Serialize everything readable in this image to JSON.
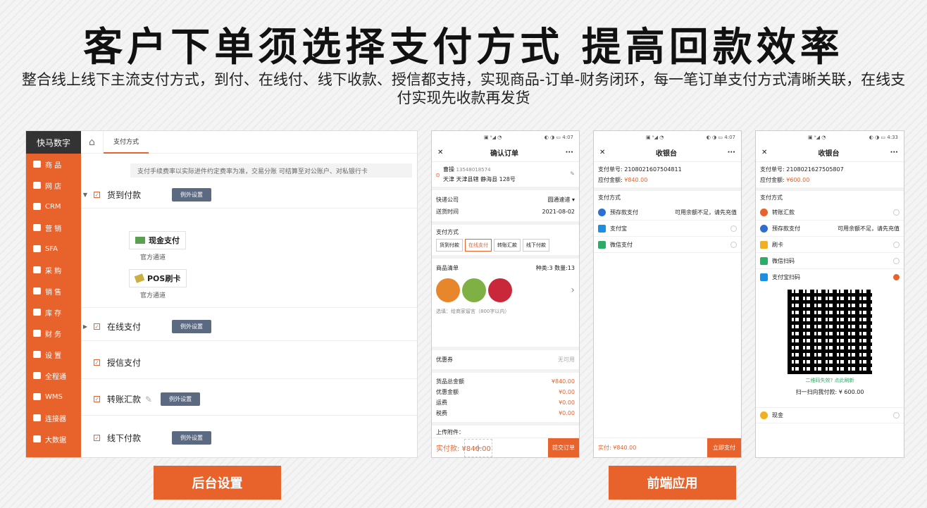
{
  "header": {
    "title": "客户下单须选择支付方式  提高回款效率",
    "subtitle": "整合线上线下主流支付方式，到付、在线付、线下收款、授信都支持，实现商品-订单-财务闭环，每一笔订单支付方式清晰关联，在线支付实现先收款再发货"
  },
  "admin": {
    "brand": "快马数字",
    "nav": [
      "商 品",
      "网 店",
      "CRM",
      "营 销",
      "SFA",
      "采 购",
      "销 售",
      "库 存",
      "财 务",
      "设 置",
      "全程通",
      "WMS",
      "连接器",
      "大数据"
    ],
    "tab": "支付方式",
    "note": "支付手续费率以实际进件约定费率为准，交易分账 可结算至对公账户、对私银行卡",
    "groups": [
      {
        "label": "货到付款",
        "ex": "例外设置"
      },
      {
        "label": "在线支付",
        "ex": "例外设置"
      },
      {
        "label": "授信支付"
      },
      {
        "label": "转账汇款",
        "ex": "例外设置"
      },
      {
        "label": "线下付款",
        "ex": "例外设置"
      }
    ],
    "cash": {
      "name": "现金支付",
      "sub": "官方通道"
    },
    "pos": {
      "name": "POS刷卡",
      "sub": "官方通道"
    }
  },
  "phone1": {
    "status_left": "▣ ᵃ◢ ◔",
    "status_right": "◐ ◑ ▭ 4:07",
    "title": "确认订单",
    "name": "曹操",
    "phone": "13548018574",
    "addr": "天津 天津县辖 静海县 128号",
    "ship_label": "快递公司",
    "ship_val": "圆通速递",
    "date_label": "送货时间",
    "date_val": "2021-08-02",
    "pay_label": "支付方式",
    "chips": [
      "货到付款",
      "在线支付",
      "转账汇款",
      "线下付款"
    ],
    "list_label": "商品清单",
    "list_val": "种类:3 数量:13",
    "memo": "选填：给商家留言（800字以内）",
    "coupon_label": "优惠券",
    "coupon_val": "无可用",
    "sum": [
      [
        "货品总金额",
        "¥840.00"
      ],
      [
        "优惠金额",
        "¥0.00"
      ],
      [
        "运费",
        "¥0.00"
      ],
      [
        "税费",
        "¥0.00"
      ]
    ],
    "attach": "上传附件：",
    "total": "实付款: ¥840.00",
    "submit": "提交订单"
  },
  "phone2": {
    "status_left": "▣ ᵃ◢ ◔",
    "status_right": "◐ ◑ ▭ 4:07",
    "title": "收银台",
    "order": "支付单号: 2108021607504811",
    "amount_label": "应付金额: ",
    "amount": "¥840.00",
    "pay_label": "支付方式",
    "methods": [
      "预存款支付",
      "支付宝",
      "微信支付"
    ],
    "balance": "可用余额不足，请先充值",
    "total": "实付: ¥840.00",
    "go": "立即支付"
  },
  "phone3": {
    "status_left": "▣ ᵃ◢ ◔",
    "status_right": "◐ ◑ ▭ 4:33",
    "title": "收银台",
    "order": "支付单号: 2108021627505807",
    "amount_label": "应付金额: ",
    "amount": "¥600.00",
    "pay_label": "支付方式",
    "methods": [
      "转账汇款",
      "预存款支付",
      "刷卡",
      "微信扫码",
      "支付宝扫码"
    ],
    "balance": "可用余额不足，请先充值",
    "qr_tip": "二维码失效? 点此刷新",
    "qr_amt": "扫一扫向我付款: ¥ 600.00",
    "cash": "现金"
  },
  "labels": {
    "back": "后台设置",
    "front": "前端应用"
  }
}
